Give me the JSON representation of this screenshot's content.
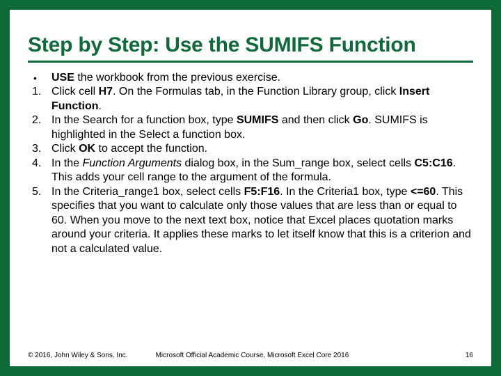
{
  "title": "Step by Step: Use the SUMIFS Function",
  "items": [
    {
      "marker": "•",
      "html": "<b>USE</b> the workbook from the previous exercise."
    },
    {
      "marker": "1.",
      "html": "Click cell <b>H7</b>. On the Formulas tab, in the Function Library group, click <b>Insert Function</b>."
    },
    {
      "marker": "2.",
      "html": "In the Search for a function box, type <b>SUMIFS</b> and then click <b>Go</b>. SUMIFS is highlighted in the Select a function box."
    },
    {
      "marker": "3.",
      "html": "Click <b>OK</b> to accept the function."
    },
    {
      "marker": "4.",
      "html": "In the <i>Function Arguments</i> dialog box, in the Sum_range box, select cells <b>C5:C16</b>. This adds your cell range to the argument of the formula."
    },
    {
      "marker": "5.",
      "html": "In the Criteria_range1 box, select cells <b>F5:F16</b>. In the Criteria1 box, type <b>&lt;=60</b>. This specifies that you want to calculate only those values that are less than or equal to 60. When you move to the next text box, notice that Excel places quotation marks around your criteria. It applies these marks to let itself know that this is a criterion and not a calculated value."
    }
  ],
  "footer": {
    "left": "© 2016, John Wiley & Sons, Inc.",
    "center": "Microsoft Official Academic Course, Microsoft Excel Core 2016",
    "right": "16"
  }
}
